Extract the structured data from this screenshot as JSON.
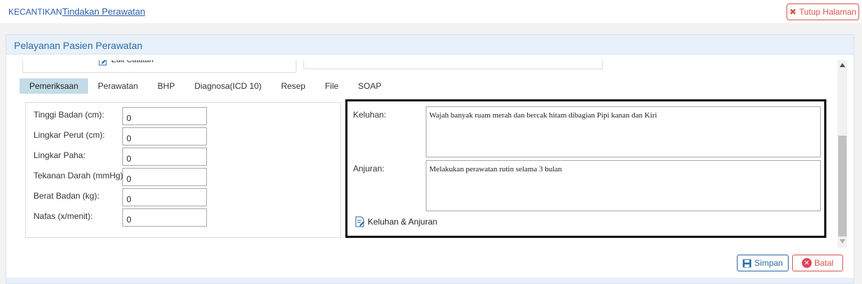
{
  "breadcrumb": {
    "root": "KECANTIKAN",
    "current": "Tindakan Perawatan"
  },
  "close_button": {
    "label": "Tutup Halaman",
    "icon": "close-icon",
    "color": "#d9534f"
  },
  "panel": {
    "title": "Pelayanan Pasien Perawatan"
  },
  "previous_section": {
    "edit_label": "Edit Catatan"
  },
  "tabs": [
    {
      "label": "Pemeriksaan",
      "active": true
    },
    {
      "label": "Perawatan",
      "active": false
    },
    {
      "label": "BHP",
      "active": false
    },
    {
      "label": "Diagnosa(ICD 10)",
      "active": false
    },
    {
      "label": "Resep",
      "active": false
    },
    {
      "label": "File",
      "active": false
    },
    {
      "label": "SOAP",
      "active": false
    }
  ],
  "vitals": [
    {
      "label": "Tinggi Badan (cm):",
      "value": "0"
    },
    {
      "label": "Lingkar Perut (cm):",
      "value": "0"
    },
    {
      "label": "Lingkar Paha:",
      "value": "0"
    },
    {
      "label": "Tekanan Darah (mmHg):",
      "value": "0"
    },
    {
      "label": "Berat Badan (kg):",
      "value": "0"
    },
    {
      "label": "Nafas (x/menit):",
      "value": "0"
    }
  ],
  "notes": {
    "keluhan_label": "Keluhan:",
    "keluhan_value": "Wajah banyak ruam merah dan bercak hitam dibagian Pipi kanan dan Kiri",
    "anjuran_label": "Anjuran:",
    "anjuran_value": "Melakukan perawatan rutin selama 3 bulan",
    "button_label": "Keluhan & Anjuran"
  },
  "actions": {
    "save_label": "Simpan",
    "cancel_label": "Batal"
  },
  "colors": {
    "accent": "#2a6aa8",
    "danger": "#d9534f",
    "tab_active": "#c3dce8"
  }
}
